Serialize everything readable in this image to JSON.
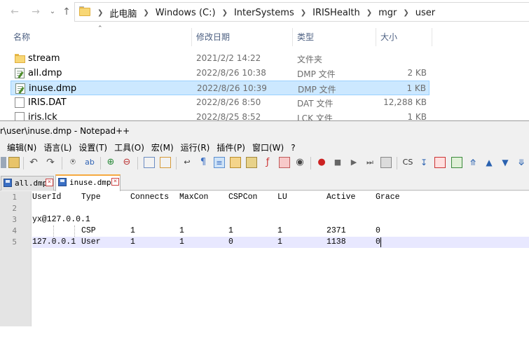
{
  "explorer": {
    "breadcrumb": [
      "此电脑",
      "Windows (C:)",
      "InterSystems",
      "IRISHealth",
      "mgr",
      "user"
    ],
    "columns": {
      "name": "名称",
      "date": "修改日期",
      "type": "类型",
      "size": "大小"
    },
    "files": [
      {
        "name": "stream",
        "date": "2021/2/2 14:22",
        "type": "文件夹",
        "size": "",
        "icon": "folder-icon",
        "selected": false
      },
      {
        "name": "all.dmp",
        "date": "2022/8/26 10:38",
        "type": "DMP 文件",
        "size": "2 KB",
        "icon": "notepad-file-icon",
        "selected": false
      },
      {
        "name": "inuse.dmp",
        "date": "2022/8/26 10:39",
        "type": "DMP 文件",
        "size": "1 KB",
        "icon": "notepad-file-icon",
        "selected": true
      },
      {
        "name": "IRIS.DAT",
        "date": "2022/8/26 8:50",
        "type": "DAT 文件",
        "size": "12,288 KB",
        "icon": "file-icon",
        "selected": false
      },
      {
        "name": "iris.lck",
        "date": "2022/8/25 8:52",
        "type": "LCK 文件",
        "size": "1 KB",
        "icon": "file-icon",
        "selected": false
      }
    ]
  },
  "npp": {
    "title": "r\\user\\inuse.dmp - Notepad++",
    "menu": [
      "编辑(N)",
      "语言(L)",
      "设置(T)",
      "工具(O)",
      "宏(M)",
      "运行(R)",
      "插件(P)",
      "窗口(W)",
      "?"
    ],
    "tabs": [
      {
        "label": "all.dmp",
        "active": false
      },
      {
        "label": "inuse.dmp",
        "active": true
      }
    ],
    "line_numbers": [
      "1",
      "2",
      "3",
      "4",
      "5"
    ],
    "headers": [
      "UserId",
      "Type",
      "Connects",
      "MaxCon",
      "CSPCon",
      "LU",
      "Active",
      "Grace"
    ],
    "line3": "yx@127.0.0.1",
    "row4": [
      "",
      "CSP",
      "1",
      "1",
      "1",
      "1",
      "2371",
      "0"
    ],
    "row5": [
      "127.0.0.1",
      "User",
      "1",
      "1",
      "0",
      "1",
      "1138",
      "0"
    ],
    "colors": {
      "tab_accent": "#f6a940",
      "current_line": "#e8e8ff",
      "selection": "#cce8ff"
    }
  }
}
